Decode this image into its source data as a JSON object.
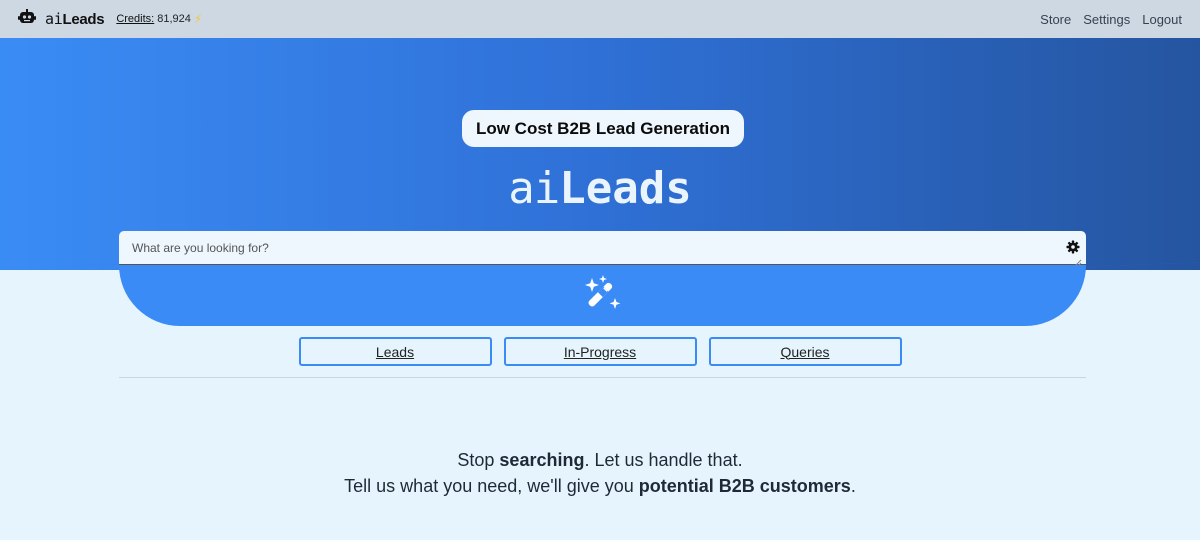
{
  "topbar": {
    "brand_ai": "ai",
    "brand_leads": "Leads",
    "credits_label": "Credits:",
    "credits_value": "81,924",
    "nav": [
      "Store",
      "Settings",
      "Logout"
    ]
  },
  "hero": {
    "badge": "Low Cost B2B Lead Generation",
    "title_ai": "ai",
    "title_leads": "Leads"
  },
  "search": {
    "placeholder": "What are you looking for?"
  },
  "tabs": [
    "Leads",
    "In-Progress",
    "Queries"
  ],
  "tagline": {
    "line1_a": "Stop ",
    "line1_b": "searching",
    "line1_c": ". Let us handle that.",
    "line2_a": "Tell us what you need, we'll give you ",
    "line2_b": "potential B2B customers",
    "line2_c": "."
  },
  "colors": {
    "topbar": "#cdd8e3",
    "hero_start": "#3a8cf5",
    "hero_end": "#2555a0",
    "accent": "#3a8bf5",
    "page_bg": "#e6f5fd"
  },
  "icons": [
    "robot-icon",
    "lightning-icon",
    "gear-icon",
    "magic-wand-icon"
  ]
}
